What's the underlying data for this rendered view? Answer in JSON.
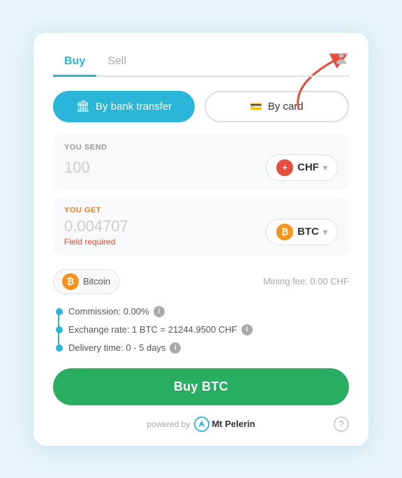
{
  "tabs": {
    "items": [
      {
        "label": "Buy",
        "active": true
      },
      {
        "label": "Sell",
        "active": false
      }
    ]
  },
  "payment": {
    "bank_label": "By bank transfer",
    "card_label": "By card"
  },
  "send": {
    "label": "YOU SEND",
    "value": "100",
    "currency": "CHF",
    "currency_symbol": "+"
  },
  "get": {
    "label": "YOU GET",
    "value": "0.004707",
    "currency": "BTC",
    "field_required": "Field required"
  },
  "coin": {
    "name": "Bitcoin",
    "mining_fee": "Mining fee: 0.00 CHF"
  },
  "details": {
    "commission": "Commission: 0.00%",
    "exchange_rate": "Exchange rate: 1 BTC = 21244.9500 CHF",
    "delivery_time": "Delivery time: 0 - 5 days"
  },
  "buy_button": "Buy BTC",
  "footer": {
    "powered_by": "powered by",
    "brand": "Mt Pelerin"
  }
}
